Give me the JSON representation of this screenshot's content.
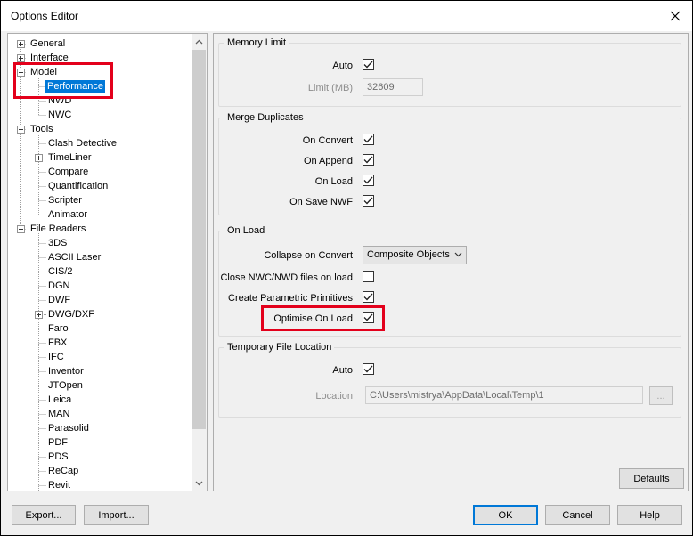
{
  "window": {
    "title": "Options Editor"
  },
  "tree": {
    "items": [
      {
        "label": "General"
      },
      {
        "label": "Interface"
      },
      {
        "label": "Model"
      },
      {
        "label": "Performance"
      },
      {
        "label": "NWD"
      },
      {
        "label": "NWC"
      },
      {
        "label": "Tools"
      },
      {
        "label": "Clash Detective"
      },
      {
        "label": "TimeLiner"
      },
      {
        "label": "Compare"
      },
      {
        "label": "Quantification"
      },
      {
        "label": "Scripter"
      },
      {
        "label": "Animator"
      },
      {
        "label": "File Readers"
      },
      {
        "label": "3DS"
      },
      {
        "label": "ASCII Laser"
      },
      {
        "label": "CIS/2"
      },
      {
        "label": "DGN"
      },
      {
        "label": "DWF"
      },
      {
        "label": "DWG/DXF"
      },
      {
        "label": "Faro"
      },
      {
        "label": "FBX"
      },
      {
        "label": "IFC"
      },
      {
        "label": "Inventor"
      },
      {
        "label": "JTOpen"
      },
      {
        "label": "Leica"
      },
      {
        "label": "MAN"
      },
      {
        "label": "Parasolid"
      },
      {
        "label": "PDF"
      },
      {
        "label": "PDS"
      },
      {
        "label": "ReCap"
      },
      {
        "label": "Revit"
      }
    ],
    "selected": "Performance"
  },
  "memory_limit": {
    "legend": "Memory Limit",
    "auto_label": "Auto",
    "auto_checked": true,
    "limit_label": "Limit (MB)",
    "limit_value": "32609"
  },
  "merge_duplicates": {
    "legend": "Merge Duplicates",
    "on_convert_label": "On Convert",
    "on_append_label": "On Append",
    "on_load_label": "On Load",
    "on_save_nwf_label": "On Save NWF"
  },
  "on_load": {
    "legend": "On Load",
    "collapse_label": "Collapse on Convert",
    "collapse_value": "Composite Objects",
    "close_files_label": "Close NWC/NWD files on load",
    "parametric_label": "Create Parametric Primitives",
    "optimise_label": "Optimise On Load"
  },
  "temp_location": {
    "legend": "Temporary File Location",
    "auto_label": "Auto",
    "location_label": "Location",
    "location_value": "C:\\Users\\mistrya\\AppData\\Local\\Temp\\1",
    "browse_label": "..."
  },
  "buttons": {
    "defaults": "Defaults",
    "export": "Export...",
    "import": "Import...",
    "ok": "OK",
    "cancel": "Cancel",
    "help": "Help"
  },
  "colors": {
    "selection": "#0078d7",
    "highlight_box": "#e3001b"
  }
}
